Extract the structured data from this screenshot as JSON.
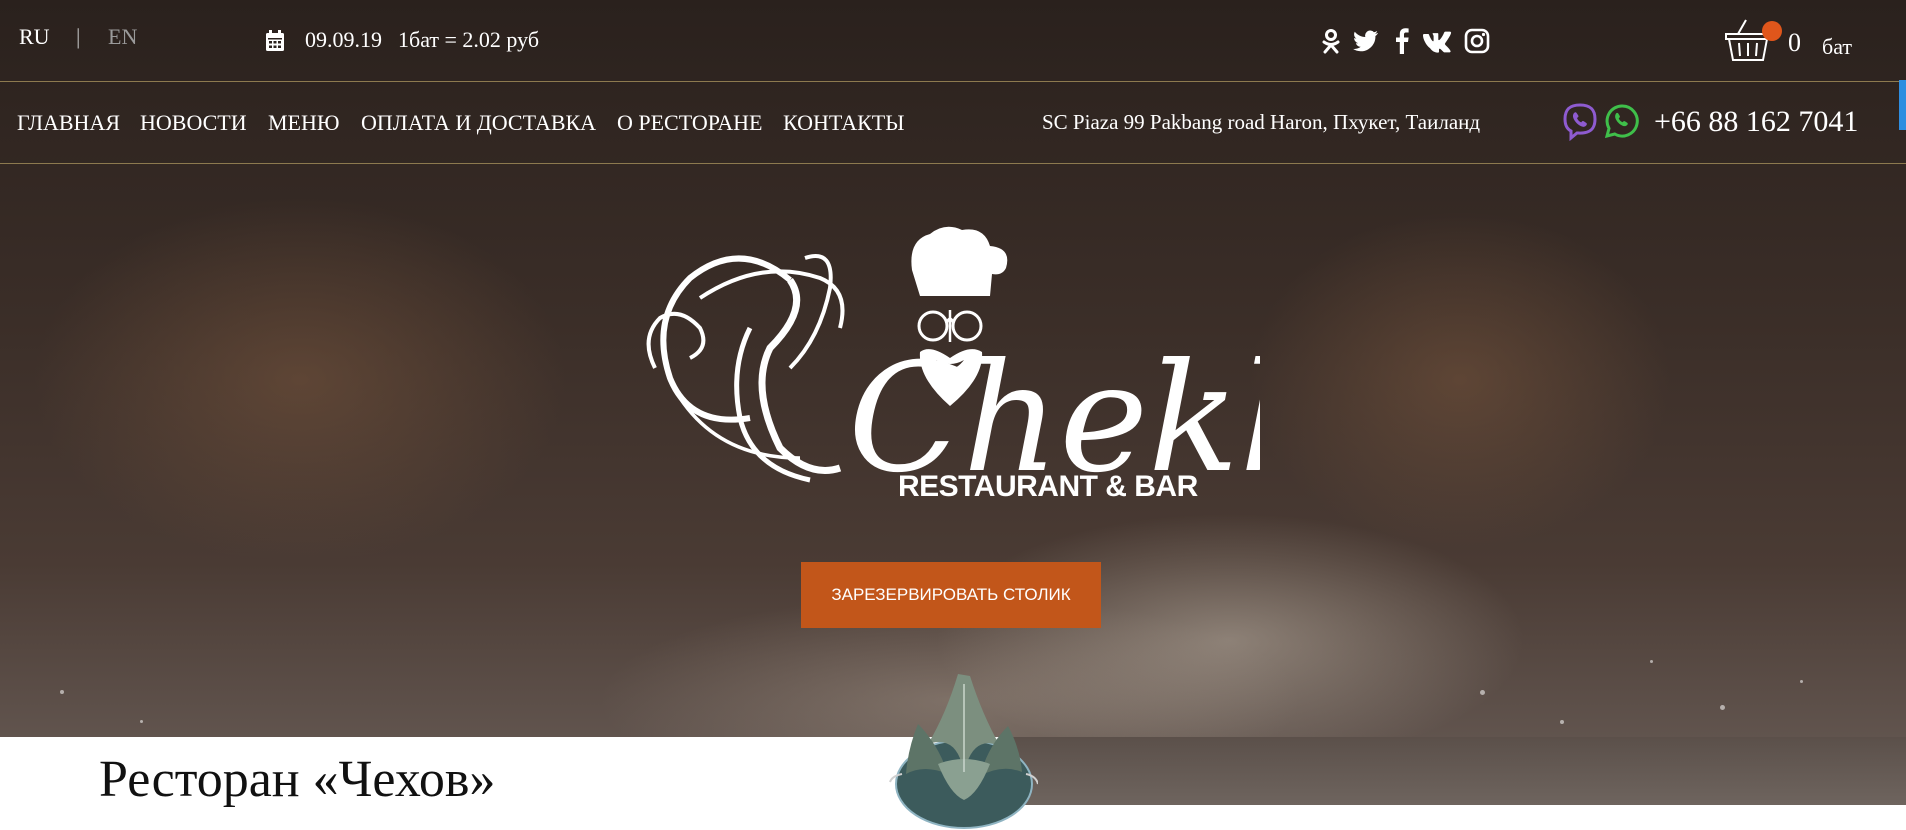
{
  "topbar": {
    "lang_ru": "RU",
    "lang_sep": "|",
    "lang_en": "EN",
    "date": "09.09.19",
    "rate": "1бат = 2.02 руб",
    "social_icons": [
      "odnoklassniki-icon",
      "twitter-icon",
      "facebook-icon",
      "vk-icon",
      "instagram-icon"
    ],
    "cart_count": "0",
    "cart_currency": "бат"
  },
  "nav": {
    "items": [
      "ГЛАВНАЯ",
      "НОВОСТИ",
      "МЕНЮ",
      "ОПЛАТА И ДОСТАВКА",
      "О РЕСТОРАНЕ",
      "КОНТАКТЫ"
    ],
    "address": "SC Piaza 99 Pakbang road Haron, Пхукет, Таиланд",
    "phone": "+66 88 162 7041",
    "messenger_icons": [
      "viber-icon",
      "whatsapp-icon"
    ]
  },
  "hero": {
    "logo_text": "Chekhoff",
    "logo_subtitle": "RESTAURANT & BAR",
    "reserve_button": "ЗАРЕЗЕРВИРОВАТЬ СТОЛИК"
  },
  "section": {
    "title": "Ресторан «Чехов»"
  },
  "colors": {
    "accent": "#c2561a",
    "cart_badge": "#e0561b",
    "divider": "#8d7a4f",
    "viber": "#8e5bd0",
    "whatsapp": "#3fbf4a"
  }
}
